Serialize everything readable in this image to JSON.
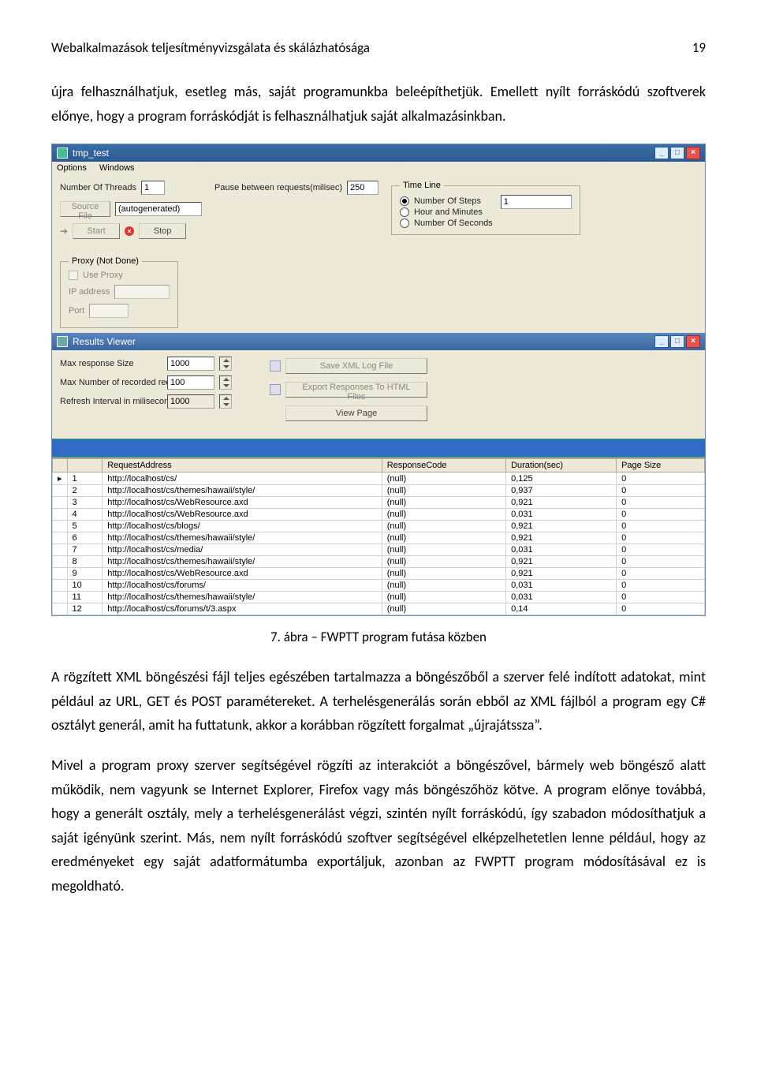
{
  "header": {
    "title": "Webalkalmazások teljesítményvizsgálata és skálázhatósága",
    "page_num": "19"
  },
  "para1": "újra felhasználhatjuk, esetleg más, saját programunkba beleépíthetjük. Emellett nyílt forráskódú szoftverek előnye, hogy a program forráskódját is felhasználhatjuk saját alkalmazásinkban.",
  "caption": "7. ábra – FWPTT program futása közben",
  "para2": "A rögzített XML böngészési fájl teljes egészében tartalmazza a böngészőből a szerver felé indított adatokat, mint például az URL, GET és POST paramétereket. A terhelésgenerálás során ebből az XML fájlból a program egy C# osztályt generál, amit ha futtatunk, akkor a korábban rögzített forgalmat „újrajátssza”.",
  "para3": "Mivel a program proxy szerver segítségével rögzíti az interakciót a böngészővel, bármely web böngésző alatt működik, nem vagyunk se Internet Explorer, Firefox vagy más böngészőhöz kötve. A program előnye továbbá, hogy a generált osztály, mely a terhelésgenerálást végzi, szintén nyílt forráskódú, így szabadon módosíthatjuk a saját igényünk szerint. Más, nem nyílt forráskódú szoftver segítségével elképzelhetetlen lenne például, hogy az eredményeket egy saját adatformátumba exportáljuk, azonban az FWPTT program módosításával ez is megoldható.",
  "app": {
    "title": "tmp_test",
    "menu": {
      "options": "Options",
      "windows": "Windows"
    },
    "threads_label": "Number Of Threads",
    "threads_value": "1",
    "pause_label": "Pause between requests(milisec)",
    "pause_value": "250",
    "source_label": "Source File",
    "source_value": "(autogenerated)",
    "start": "Start",
    "stop": "Stop",
    "timeline": {
      "legend": "Time Line",
      "steps": "Number Of Steps",
      "hm": "Hour and Minutes",
      "seconds": "Number Of Seconds",
      "value": "1"
    },
    "proxy": {
      "legend": "Proxy (Not Done)",
      "use": "Use Proxy",
      "ip": "IP address",
      "port": "Port"
    }
  },
  "results": {
    "title": "Results Viewer",
    "max_resp": "Max response Size",
    "max_resp_val": "1000",
    "max_rec": "Max Number of recorded requests",
    "max_rec_val": "100",
    "refresh": "Refresh Interval in miliseconds",
    "refresh_val": "1000",
    "save_xml": "Save XML Log File",
    "export_html": "Export Responses To HTML Files",
    "view_page": "View Page"
  },
  "table": {
    "headers": {
      "empty": "",
      "addr": "RequestAddress",
      "code": "ResponseCode",
      "dur": "Duration(sec)",
      "size": "Page Size"
    },
    "rows": [
      {
        "n": "1",
        "addr": "http://localhost/cs/",
        "code": "(null)",
        "dur": "0,125",
        "size": "0"
      },
      {
        "n": "2",
        "addr": "http://localhost/cs/themes/hawaii/style/",
        "code": "(null)",
        "dur": "0,937",
        "size": "0"
      },
      {
        "n": "3",
        "addr": "http://localhost/cs/WebResource.axd",
        "code": "(null)",
        "dur": "0,921",
        "size": "0"
      },
      {
        "n": "4",
        "addr": "http://localhost/cs/WebResource.axd",
        "code": "(null)",
        "dur": "0,031",
        "size": "0"
      },
      {
        "n": "5",
        "addr": "http://localhost/cs/blogs/",
        "code": "(null)",
        "dur": "0,921",
        "size": "0"
      },
      {
        "n": "6",
        "addr": "http://localhost/cs/themes/hawaii/style/",
        "code": "(null)",
        "dur": "0,921",
        "size": "0"
      },
      {
        "n": "7",
        "addr": "http://localhost/cs/media/",
        "code": "(null)",
        "dur": "0,031",
        "size": "0"
      },
      {
        "n": "8",
        "addr": "http://localhost/cs/themes/hawaii/style/",
        "code": "(null)",
        "dur": "0,921",
        "size": "0"
      },
      {
        "n": "9",
        "addr": "http://localhost/cs/WebResource.axd",
        "code": "(null)",
        "dur": "0,921",
        "size": "0"
      },
      {
        "n": "10",
        "addr": "http://localhost/cs/forums/",
        "code": "(null)",
        "dur": "0,031",
        "size": "0"
      },
      {
        "n": "11",
        "addr": "http://localhost/cs/themes/hawaii/style/",
        "code": "(null)",
        "dur": "0,031",
        "size": "0"
      },
      {
        "n": "12",
        "addr": "http://localhost/cs/forums/t/3.aspx",
        "code": "(null)",
        "dur": "0,14",
        "size": "0"
      }
    ]
  }
}
